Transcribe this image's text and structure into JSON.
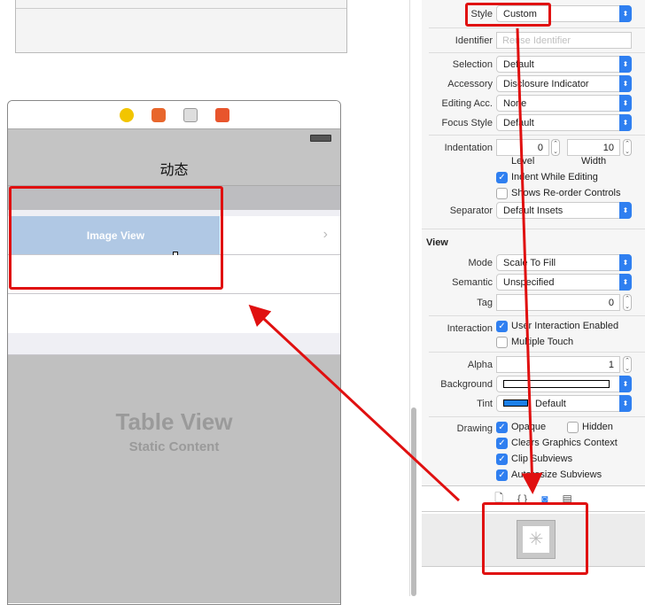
{
  "canvas": {
    "dock_icons": [
      "view-controller-icon",
      "first-responder-icon",
      "table-view-icon",
      "exit-icon"
    ],
    "nav_title": "动态",
    "image_view_label": "Image View",
    "table_view_title": "Table View",
    "table_view_subtitle": "Static Content"
  },
  "inspector": {
    "style": {
      "label": "Style",
      "value": "Custom"
    },
    "identifier": {
      "label": "Identifier",
      "placeholder": "Reuse Identifier"
    },
    "selection": {
      "label": "Selection",
      "value": "Default"
    },
    "accessory": {
      "label": "Accessory",
      "value": "Disclosure Indicator"
    },
    "editing_acc": {
      "label": "Editing Acc.",
      "value": "None"
    },
    "focus_style": {
      "label": "Focus Style",
      "value": "Default"
    },
    "indentation": {
      "label": "Indentation",
      "level": "0",
      "width": "10",
      "level_label": "Level",
      "width_label": "Width"
    },
    "indent_while_editing": {
      "label": "Indent While Editing",
      "checked": true
    },
    "shows_reorder": {
      "label": "Shows Re-order Controls",
      "checked": false
    },
    "separator": {
      "label": "Separator",
      "value": "Default Insets"
    },
    "view_section": "View",
    "mode": {
      "label": "Mode",
      "value": "Scale To Fill"
    },
    "semantic": {
      "label": "Semantic",
      "value": "Unspecified"
    },
    "tag": {
      "label": "Tag",
      "value": "0"
    },
    "interaction": {
      "label": "Interaction",
      "user_interaction": "User Interaction Enabled",
      "multiple_touch": "Multiple Touch"
    },
    "alpha": {
      "label": "Alpha",
      "value": "1"
    },
    "background": {
      "label": "Background",
      "color": "#ffffff"
    },
    "tint": {
      "label": "Tint",
      "value": "Default",
      "color": "#1a7fe8"
    },
    "drawing": {
      "label": "Drawing",
      "opaque": "Opaque",
      "hidden": "Hidden",
      "clears": "Clears Graphics Context",
      "clip": "Clip Subviews",
      "autoresize": "Autoresize Subviews"
    }
  },
  "library": {
    "tabs": [
      "file-icon",
      "braces-icon",
      "object-icon",
      "media-icon"
    ],
    "item": "image-view-icon"
  },
  "colors": {
    "accent": "#2f7ff0",
    "annotation": "#e01010"
  }
}
